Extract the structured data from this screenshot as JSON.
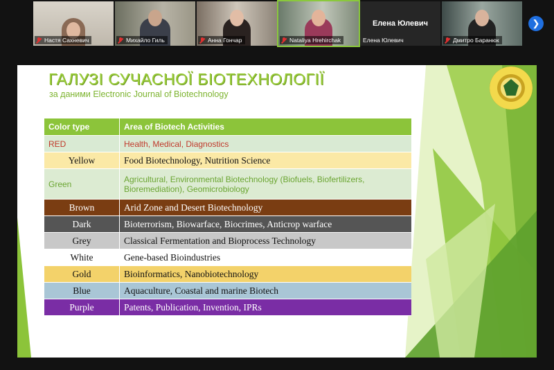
{
  "participants": [
    {
      "name": "Настя Сахневич",
      "muted": true
    },
    {
      "name": "Михайло Гиль",
      "muted": true
    },
    {
      "name": "Анна Гончар",
      "muted": true
    },
    {
      "name": "Nataliya Hrehirchak",
      "muted": true
    },
    {
      "name": "Елена Юлевич",
      "big_name": "Елена Юлевич",
      "muted": false
    },
    {
      "name": "Дмитро Баранюк",
      "muted": true
    }
  ],
  "slide": {
    "title": "ГАЛУЗІ СУЧАСНОЇ БІОТЕХНОЛОГІЇ",
    "subtitle": "за даними Electronic Journal of Biotechnology",
    "table": {
      "headers": [
        "Color type",
        "Area of Biotech Activities"
      ],
      "rows": [
        {
          "color": "RED",
          "area": "Health, Medical, Diagnostics",
          "bg": "#d9ead3",
          "fg": "#c0392b"
        },
        {
          "color": "Yellow",
          "area": "Food Biotechnology, Nutrition Science",
          "bg": "#fbe9a6",
          "fg": "#111111"
        },
        {
          "color": "Green",
          "area": "Agricultural, Environmental Biotechnology (Biofuels, Biofertilizers, Bioremediation), Geomicrobiology",
          "bg": "#dcebd2",
          "fg": "#6aa531"
        },
        {
          "color": "Brown",
          "area": "Arid Zone and Desert Biotechnology",
          "bg": "#7a3d12",
          "fg": "#ffffff"
        },
        {
          "color": "Dark",
          "area": "Bioterrorism, Biowarface, Biocrimes, Anticrop warface",
          "bg": "#555555",
          "fg": "#ffffff"
        },
        {
          "color": "Grey",
          "area": "Classical Fermentation and Bioprocess Technology",
          "bg": "#c8c8c8",
          "fg": "#111111"
        },
        {
          "color": "White",
          "area": "Gene-based Bioindustries",
          "bg": "#ffffff",
          "fg": "#111111"
        },
        {
          "color": "Gold",
          "area": "Bioinformatics, Nanobiotechnology",
          "bg": "#f3d26a",
          "fg": "#111111"
        },
        {
          "color": "Blue",
          "area": "Aquaculture, Coastal and marine Biotech",
          "bg": "#a9c6d6",
          "fg": "#111111"
        },
        {
          "color": "Purple",
          "area": "Patents, Publication, Invention, IPRs",
          "bg": "#7a2da5",
          "fg": "#ffffff"
        }
      ]
    }
  },
  "colors": {
    "accent_green": "#8cc43a",
    "zoom_blue": "#1f6fe0"
  }
}
